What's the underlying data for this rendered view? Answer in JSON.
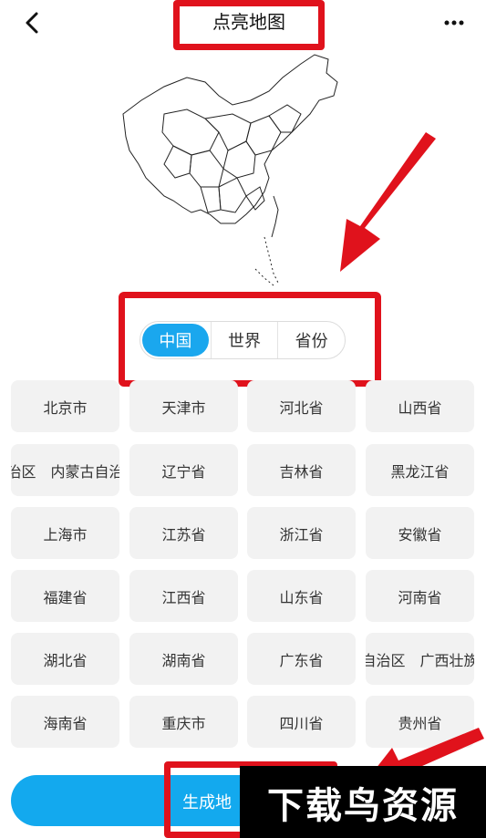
{
  "header": {
    "title": "点亮地图",
    "back_icon": "chevron-left-icon",
    "more_icon": "more-dots-icon"
  },
  "tabs": [
    {
      "label": "中国",
      "active": true
    },
    {
      "label": "世界",
      "active": false
    },
    {
      "label": "省份",
      "active": false
    }
  ],
  "regions": [
    "北京市",
    "天津市",
    "河北省",
    "山西省",
    "治区　内蒙古自治",
    "辽宁省",
    "吉林省",
    "黑龙江省",
    "上海市",
    "江苏省",
    "浙江省",
    "安徽省",
    "福建省",
    "江西省",
    "山东省",
    "河南省",
    "湖北省",
    "湖南省",
    "广东省",
    "自治区　广西壮族",
    "海南省",
    "重庆市",
    "四川省",
    "贵州省"
  ],
  "bottom": {
    "generate_label": "生成地",
    "watermark": "下载鸟资源"
  },
  "colors": {
    "accent": "#1aa7ee",
    "annotation_red": "#e0121c",
    "tile_bg": "#f2f2f2"
  }
}
